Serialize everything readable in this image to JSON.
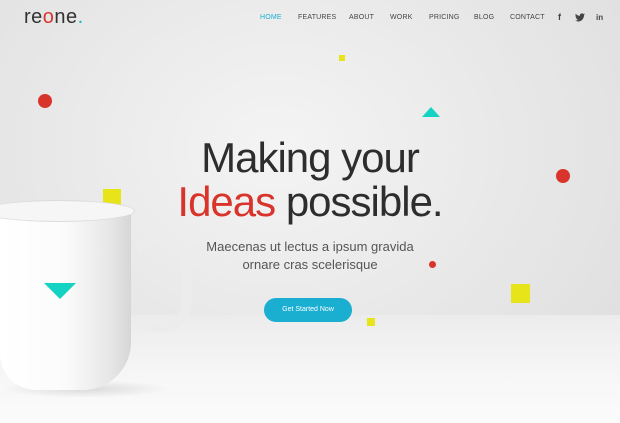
{
  "header": {
    "logo": {
      "pre": "re",
      "o": "o",
      "post": "ne",
      "dot": "."
    },
    "nav": [
      {
        "label": "HOME",
        "active": true
      },
      {
        "label": "FEATURES",
        "active": false
      },
      {
        "label": "ABOUT",
        "active": false
      },
      {
        "label": "WORK",
        "active": false
      },
      {
        "label": "PRICING",
        "active": false
      },
      {
        "label": "BLOG",
        "active": false
      },
      {
        "label": "CONTACT",
        "active": false
      }
    ],
    "social": [
      {
        "icon": "facebook-icon",
        "glyph": "f"
      },
      {
        "icon": "twitter-icon",
        "glyph": "🐦"
      },
      {
        "icon": "linkedin-icon",
        "glyph": "in"
      }
    ]
  },
  "hero": {
    "line1": "Making your",
    "accent": "Ideas",
    "line2_rest": " possible.",
    "sub_line1": "Maecenas ut lectus a ipsum gravida",
    "sub_line2": "ornare cras scelerisque",
    "cta": "Get Started Now"
  },
  "colors": {
    "accent": "#1aaed1",
    "red": "#d9342b",
    "yellow": "#e8e41a",
    "teal": "#15d3c3"
  }
}
